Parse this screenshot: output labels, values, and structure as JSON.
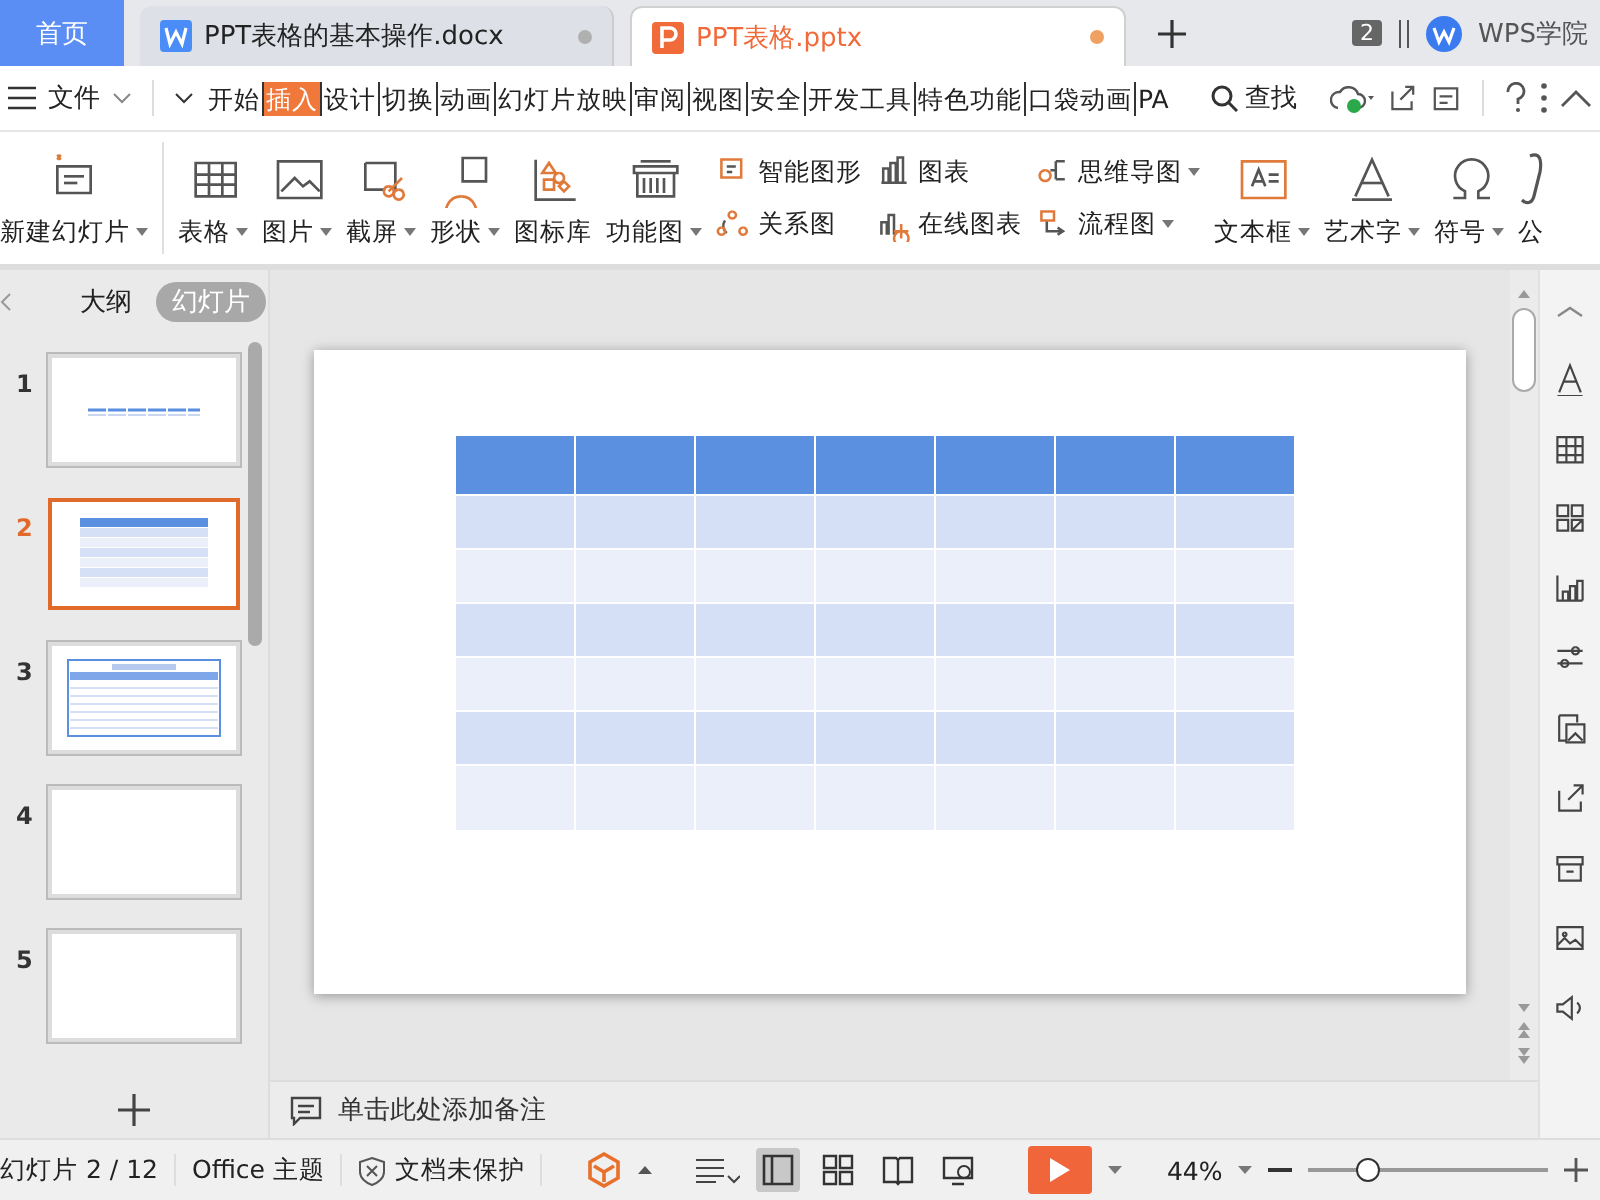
{
  "tabs": [
    {
      "kind": "home",
      "label": "首页",
      "selected": false
    },
    {
      "kind": "doc",
      "label": "PPT表格的基本操作.docx",
      "selected": false,
      "modified": true
    },
    {
      "kind": "ppt",
      "label": "PPT表格.pptx",
      "selected": true,
      "modified": true
    }
  ],
  "window_count": "2",
  "account": "WPS学院",
  "menu": {
    "file": "文件",
    "tabs": [
      {
        "label": "开始",
        "selected": false
      },
      {
        "label": "插入",
        "selected": true
      },
      {
        "label": "设计",
        "selected": false
      },
      {
        "label": "切换",
        "selected": false
      },
      {
        "label": "动画",
        "selected": false
      },
      {
        "label": "幻灯片放映",
        "selected": false
      },
      {
        "label": "审阅",
        "selected": false
      },
      {
        "label": "视图",
        "selected": false
      },
      {
        "label": "安全",
        "selected": false
      },
      {
        "label": "开发工具",
        "selected": false
      },
      {
        "label": "特色功能",
        "selected": false
      },
      {
        "label": "口袋动画",
        "selected": false
      },
      {
        "label": "PA",
        "selected": false
      }
    ],
    "search": "查找"
  },
  "ribbon": [
    {
      "kind": "big",
      "label": "新建幻灯片",
      "dropdown": true
    },
    {
      "kind": "big",
      "label": "表格",
      "dropdown": true
    },
    {
      "kind": "big",
      "label": "图片",
      "dropdown": true
    },
    {
      "kind": "big",
      "label": "截屏",
      "dropdown": true
    },
    {
      "kind": "big",
      "label": "形状",
      "dropdown": true
    },
    {
      "kind": "big",
      "label": "图标库",
      "dropdown": false
    },
    {
      "kind": "big",
      "label": "功能图",
      "dropdown": true
    },
    {
      "kind": "pair",
      "items": [
        {
          "label": "智能图形",
          "dropdown": false
        },
        {
          "label": "关系图",
          "dropdown": false
        }
      ]
    },
    {
      "kind": "pair",
      "items": [
        {
          "label": "图表",
          "dropdown": false
        },
        {
          "label": "在线图表",
          "dropdown": false
        }
      ]
    },
    {
      "kind": "pair",
      "items": [
        {
          "label": "思维导图",
          "dropdown": true
        },
        {
          "label": "流程图",
          "dropdown": true
        }
      ]
    },
    {
      "kind": "big",
      "label": "文本框",
      "dropdown": true
    },
    {
      "kind": "big",
      "label": "艺术字",
      "dropdown": true
    },
    {
      "kind": "big",
      "label": "符号",
      "dropdown": true
    },
    {
      "kind": "big",
      "label": "公",
      "dropdown": false
    }
  ],
  "panel": {
    "views": [
      {
        "label": "大纲",
        "selected": false
      },
      {
        "label": "幻灯片",
        "selected": true
      }
    ],
    "slides": [
      {
        "number": "1",
        "kind": "title",
        "selected": false
      },
      {
        "number": "2",
        "kind": "table",
        "selected": true
      },
      {
        "number": "3",
        "kind": "form",
        "selected": false
      },
      {
        "number": "4",
        "kind": "blank",
        "selected": false
      },
      {
        "number": "5",
        "kind": "blank",
        "selected": false
      }
    ]
  },
  "slide": {
    "table_rows": [
      {
        "kind": "header"
      },
      {
        "kind": "band"
      },
      {
        "kind": "plain"
      },
      {
        "kind": "band"
      },
      {
        "kind": "plain"
      },
      {
        "kind": "band"
      },
      {
        "kind": "plain"
      }
    ]
  },
  "notes_placeholder": "单击此处添加备注",
  "status": {
    "slide": "幻灯片 2 / 12",
    "theme": "Office 主题",
    "protection": "文档未保护",
    "zoom": "44%",
    "zoom_slider": {
      "level": 0.25
    }
  }
}
